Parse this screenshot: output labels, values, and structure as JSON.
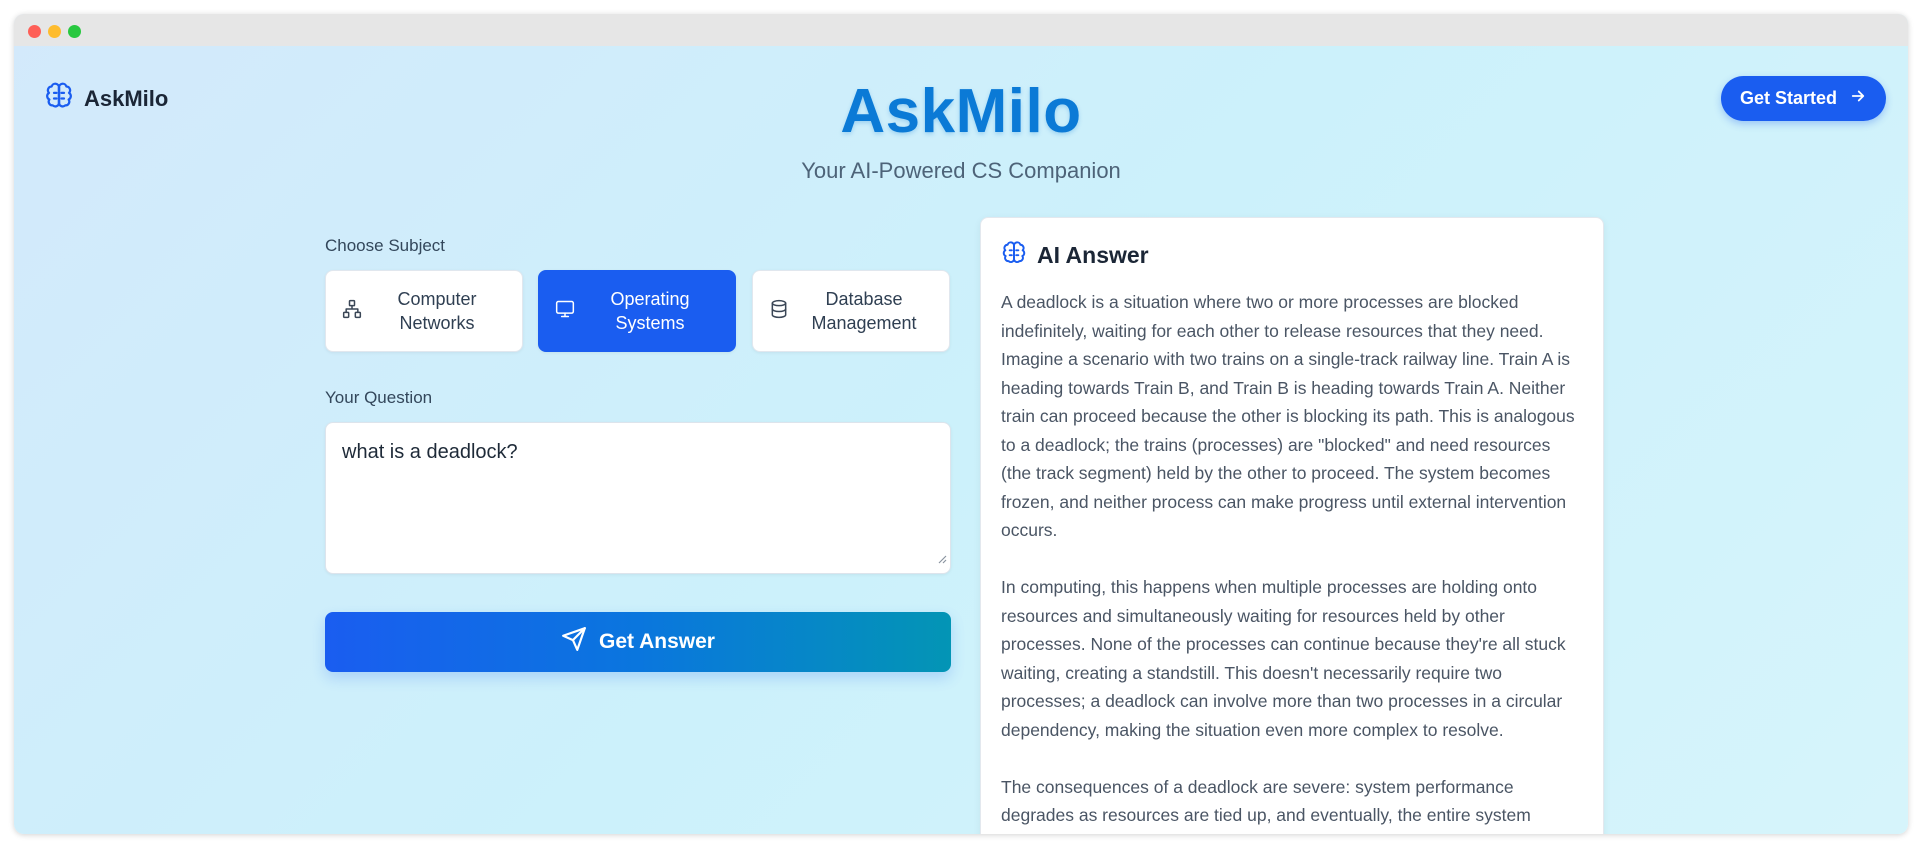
{
  "brand": {
    "name": "AskMilo",
    "icon": "brain-icon"
  },
  "header": {
    "cta_label": "Get Started",
    "cta_icon": "arrow-right-icon"
  },
  "hero": {
    "title": "AskMilo",
    "subtitle": "Your AI-Powered CS Companion"
  },
  "subjects": {
    "label": "Choose Subject",
    "items": [
      {
        "label": "Computer\nNetworks",
        "icon": "network-icon",
        "selected": false
      },
      {
        "label": "Operating\nSystems",
        "icon": "monitor-icon",
        "selected": true
      },
      {
        "label": "Database\nManagement",
        "icon": "database-icon",
        "selected": false
      }
    ]
  },
  "question": {
    "label": "Your Question",
    "value": "what is a deadlock?"
  },
  "submit": {
    "label": "Get Answer",
    "icon": "send-icon"
  },
  "answer": {
    "title": "AI Answer",
    "icon": "brain-icon",
    "paragraphs": [
      "A deadlock is a situation where two or more processes are blocked indefinitely, waiting for each other to release resources that they need.  Imagine a scenario with two trains on a single-track railway line.  Train A is heading towards Train B, and Train B is heading towards Train A.  Neither train can proceed because the other is blocking its path.  This is analogous to a deadlock; the trains (processes) are \"blocked\" and need resources (the track segment) held by the other to proceed.  The system becomes frozen, and neither process can make progress until external intervention occurs.",
      "In computing, this happens when multiple processes are holding onto resources and simultaneously waiting for resources held by other processes.  None of the processes can continue because they're all stuck waiting, creating a standstill.  This doesn't necessarily require two processes; a deadlock can involve more than two processes in a circular dependency, making the situation even more complex to resolve.",
      "The consequences of a deadlock are severe: system performance degrades as resources are tied up, and eventually, the entire system"
    ]
  },
  "colors": {
    "accent": "#1a5df0",
    "title": "#0b7ad6",
    "gradient_end": "#0395b5"
  }
}
